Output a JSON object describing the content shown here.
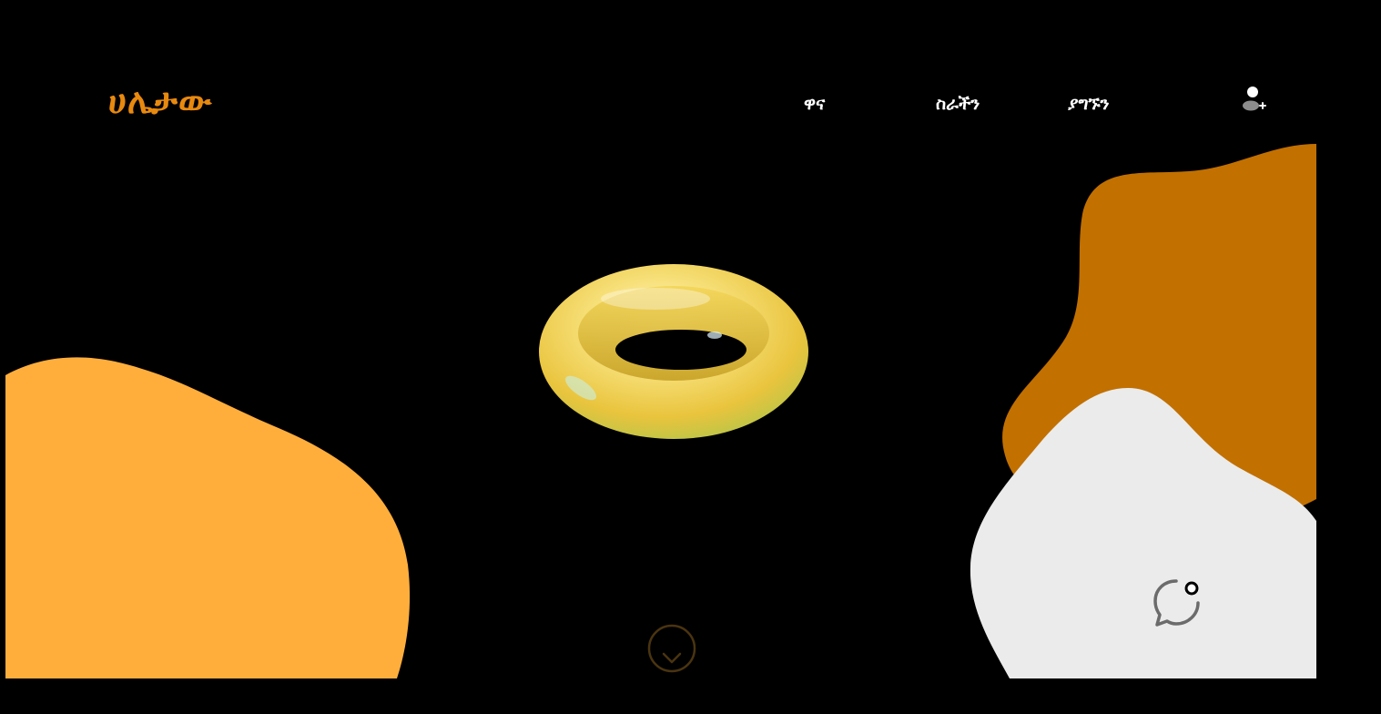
{
  "brand": {
    "logo_text": "ሀሌታው"
  },
  "nav": {
    "items": [
      {
        "label": "ዋና"
      },
      {
        "label": "ስራችን"
      },
      {
        "label": "ያግኙን"
      }
    ]
  },
  "icons": {
    "user": "add-user-icon",
    "scroll": "chevron-down-icon",
    "chat": "chat-bubble-icon"
  },
  "colors": {
    "background": "#000000",
    "logo": "#e8890f",
    "blob_light_orange": "#ffae3c",
    "blob_dark_orange": "#c27000",
    "blob_light_gray": "#ebebeb",
    "torus": "#f5d24a",
    "scroll_ring": "#4a3410",
    "chat_icon": "#6b6b6b",
    "nav_text": "#ffffff"
  }
}
